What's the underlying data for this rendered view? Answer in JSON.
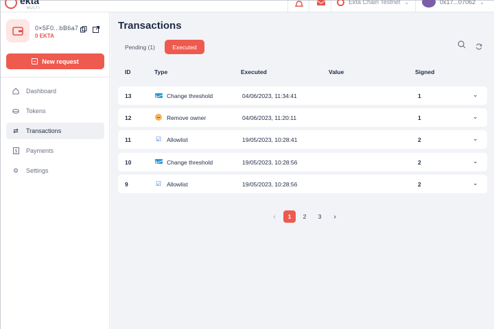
{
  "app": {
    "logo_text": "ekta",
    "logo_sub": "MULTI",
    "network": "Ekta Chain Testnet",
    "account": "0x17...07062"
  },
  "wallet": {
    "address": "0×5F0...bB6a7",
    "balance": "0  EKTA"
  },
  "sidebar": {
    "new_request_label": "New request",
    "items": [
      {
        "label": "Dashboard",
        "icon": "home-icon"
      },
      {
        "label": "Tokens",
        "icon": "coins-icon"
      },
      {
        "label": "Transactions",
        "icon": "transfer-icon",
        "active": true
      },
      {
        "label": "Payments",
        "icon": "payments-icon"
      },
      {
        "label": "Settings",
        "icon": "gear-icon"
      }
    ]
  },
  "main": {
    "title": "Transactions",
    "tabs": [
      {
        "label": "Pending (1)",
        "active": false
      },
      {
        "label": "Executed",
        "active": true
      }
    ],
    "columns": {
      "id": "ID",
      "type": "Type",
      "executed": "Executed",
      "value": "Value",
      "signed": "Signed"
    },
    "rows": [
      {
        "id": "13",
        "type": "Change threshold",
        "type_icon": "threshold-icon",
        "executed": "04/06/2023, 11:34:41",
        "value": "",
        "signed": "1"
      },
      {
        "id": "12",
        "type": "Remove owner",
        "type_icon": "remove-owner-icon",
        "executed": "04/06/2023, 11:20:11",
        "value": "",
        "signed": "1"
      },
      {
        "id": "11",
        "type": "Allowlist",
        "type_icon": "allowlist-icon",
        "executed": "19/05/2023, 10:28:41",
        "value": "",
        "signed": "2"
      },
      {
        "id": "10",
        "type": "Change threshold",
        "type_icon": "threshold-icon",
        "executed": "19/05/2023, 10:28:56",
        "value": "",
        "signed": "2"
      },
      {
        "id": "9",
        "type": "Allowlist",
        "type_icon": "allowlist-icon",
        "executed": "19/05/2023, 10:28:56",
        "value": "",
        "signed": "2"
      }
    ],
    "pagination": {
      "pages": [
        "1",
        "2",
        "3"
      ],
      "current": "1",
      "prev": "‹",
      "next": "›"
    }
  },
  "colors": {
    "accent": "#ef5a4f",
    "background": "#f1f3f7",
    "text": "#1f2a44"
  }
}
